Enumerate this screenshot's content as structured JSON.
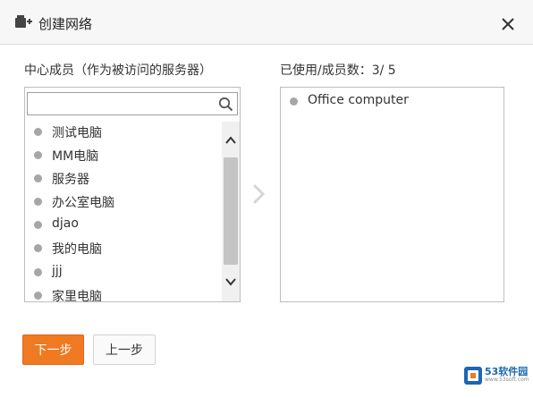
{
  "dialog": {
    "title": "创建网络",
    "close_label": "×"
  },
  "left_panel": {
    "label": "中心成员（作为被访问的服务器）",
    "search": {
      "value": "",
      "placeholder": ""
    },
    "items": [
      {
        "label": "测试电脑"
      },
      {
        "label": "MM电脑"
      },
      {
        "label": "服务器"
      },
      {
        "label": "办公室电脑"
      },
      {
        "label": "djao"
      },
      {
        "label": "我的电脑"
      },
      {
        "label": "jjj"
      },
      {
        "label": "家里电脑"
      }
    ]
  },
  "right_panel": {
    "label": "已使用/成员数：3/ 5",
    "items": [
      {
        "label": "Office computer"
      }
    ]
  },
  "buttons": {
    "next_label": "下一步",
    "prev_label": "上一步"
  },
  "colors": {
    "accent": "#f07a22",
    "dot": "#a6a6a6"
  },
  "watermark": {
    "text": "53软件园",
    "url": "www.53soft.com"
  }
}
